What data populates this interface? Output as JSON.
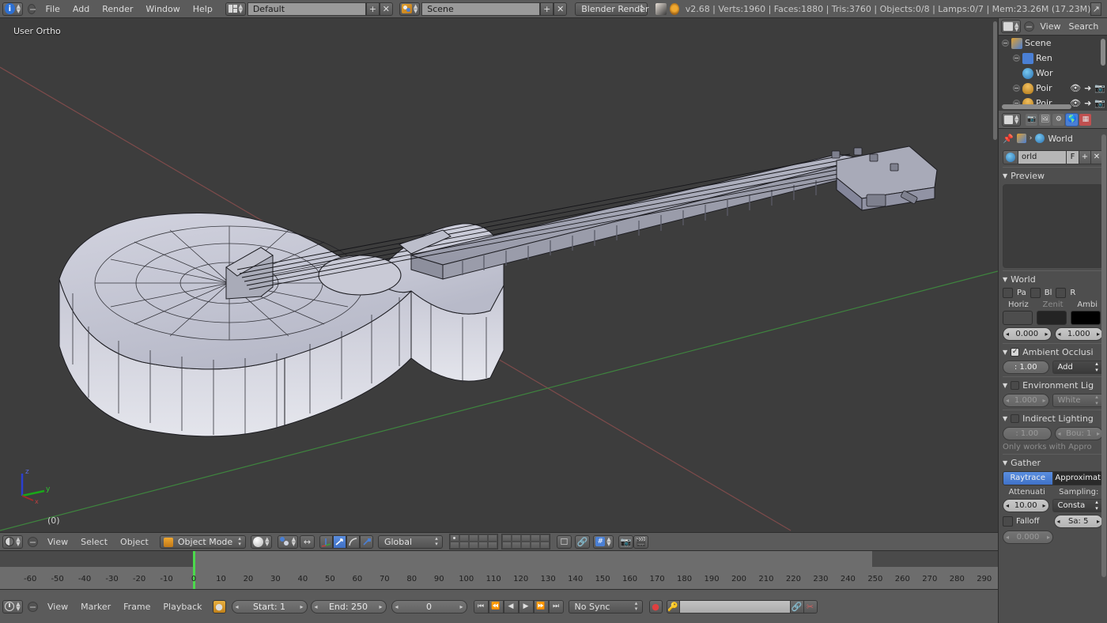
{
  "topbar": {
    "editor_icon": "info-editor-icon",
    "menus": [
      "File",
      "Add",
      "Render",
      "Window",
      "Help"
    ],
    "screen_layout": {
      "icon": "screen-layout-icon",
      "value": "Default",
      "add_label": "+",
      "remove_label": "✕"
    },
    "scene": {
      "icon": "scene-icon",
      "value": "Scene",
      "add_label": "+",
      "remove_label": "✕"
    },
    "render_engine": "Blender Render",
    "status": "v2.68 | Verts:1960 | Faces:1880 | Tris:3760 | Objects:0/8 | Lamps:0/7 | Mem:23.26M (17.23M)",
    "maximize_icon": "maximize-icon"
  },
  "viewport": {
    "view_label": "User Ortho",
    "frame_indicator": "(0)",
    "axis_labels": {
      "x": "x",
      "y": "y",
      "z": "z"
    },
    "colors": {
      "background": "#3d3d3d",
      "x_axis": "#8c4a4a",
      "y_axis": "#3f8c3f",
      "mesh_light": "#c7c8d4",
      "mesh_dark": "#8e909e"
    }
  },
  "viewport_header": {
    "editor_icon": "3d-view-editor-icon",
    "menus": [
      "View",
      "Select",
      "Object"
    ],
    "mode": {
      "icon": "object-mode-icon",
      "value": "Object Mode"
    },
    "shading": {
      "icon": "solid-shading-icon"
    },
    "pivot": {
      "icon": "pivot-median-icon"
    },
    "snap_onion": {
      "icon": "snap-onion-icon"
    },
    "manipulators": [
      {
        "name": "translate-manipulator-icon",
        "active": false
      },
      {
        "name": "rotate-manipulator-icon",
        "active": true
      },
      {
        "name": "arc-manipulator-icon",
        "active": false
      },
      {
        "name": "scale-manipulator-icon",
        "active": false
      }
    ],
    "transform_orientation": "Global",
    "layers": {
      "group_one": [
        true,
        false,
        false,
        false,
        false,
        false,
        false,
        false,
        false,
        false
      ],
      "group_two": [
        false,
        false,
        false,
        false,
        false,
        false,
        false,
        false,
        false,
        false
      ]
    },
    "extra_icons": [
      "render-border-icon",
      "magnet-snap-icon",
      "snap-element-icon",
      "render-preview-icon",
      "render-animation-icon"
    ]
  },
  "timeline": {
    "ruler_ticks": [
      -60,
      -50,
      -40,
      -30,
      -20,
      -10,
      0,
      10,
      20,
      30,
      40,
      50,
      60,
      70,
      80,
      90,
      100,
      110,
      120,
      130,
      140,
      150,
      160,
      170,
      180,
      190,
      200,
      210,
      220,
      230,
      240,
      250,
      260,
      270,
      280,
      290
    ],
    "playhead_frame": 0,
    "editor_icon": "timeline-editor-icon",
    "menus": [
      "View",
      "Marker",
      "Frame",
      "Playback"
    ],
    "record_icon": "auto-key-icon",
    "start": "Start: 1",
    "end": "End: 250",
    "current_frame": "0",
    "playback_buttons": [
      "jump-start-icon",
      "prev-keyframe-icon",
      "play-reverse-icon",
      "play-icon",
      "next-keyframe-icon",
      "jump-end-icon"
    ],
    "sync_mode": "No Sync",
    "rec_icon": "record-icon",
    "key_icon": "keying-set-icon",
    "keying_value": "",
    "link_icon": "link-icon",
    "scissors_icon": "scissors-icon"
  },
  "outliner": {
    "editor_icon": "outliner-editor-icon",
    "menus": [
      "View",
      "Search"
    ],
    "rows": [
      {
        "indent": 0,
        "label": "Scene",
        "icon": "scene-icon",
        "expander": "collapse",
        "toggles": []
      },
      {
        "indent": 1,
        "label": "Ren",
        "icon": "renderlayers-icon",
        "expander": "expand",
        "toggles": []
      },
      {
        "indent": 1,
        "label": "Wor",
        "icon": "world-icon",
        "expander": "none",
        "toggles": []
      },
      {
        "indent": 1,
        "label": "Poir",
        "icon": "lamp-icon",
        "expander": "expand",
        "toggles": [
          "eye-icon",
          "cursor-icon",
          "camera-icon"
        ]
      },
      {
        "indent": 1,
        "label": "Poir",
        "icon": "lamp-icon",
        "expander": "expand",
        "toggles": [
          "eye-icon",
          "cursor-icon",
          "camera-icon"
        ]
      }
    ]
  },
  "properties": {
    "tabs": [
      {
        "name": "render-tab",
        "icon": "camera-back-icon",
        "active": false
      },
      {
        "name": "render-layers-tab",
        "icon": "images-icon",
        "active": false
      },
      {
        "name": "scene-tab",
        "icon": "scene-data-icon",
        "active": false
      },
      {
        "name": "world-tab",
        "icon": "world-icon",
        "active": true
      },
      {
        "name": "texture-tab",
        "icon": "checker-icon",
        "active": false
      }
    ],
    "breadcrumb": {
      "pin_icon": "pin-icon",
      "scene_icon": "scene-icon",
      "sep": "›",
      "world_icon": "world-icon",
      "label": "World"
    },
    "datablock": {
      "icon": "world-icon",
      "name": "orld",
      "fake_user": "F",
      "add": "+",
      "remove": "✕"
    },
    "panels": {
      "preview": {
        "title": "Preview"
      },
      "world": {
        "title": "World",
        "toggles": [
          {
            "label": "Pa",
            "checked": false
          },
          {
            "label": "Bl",
            "checked": false
          },
          {
            "label": "R",
            "checked": false
          }
        ],
        "color_labels": [
          "Horiz",
          "Zenit",
          "Ambi"
        ],
        "colors": [
          "#4d4d4d",
          "#242424",
          "#000000"
        ],
        "zenit_dim": true,
        "values": [
          "0.000",
          "1.000"
        ]
      },
      "ambient_occlusion": {
        "title": "Ambient Occlusi",
        "checked": true,
        "factor": ": 1.00",
        "blend_mode": "Add"
      },
      "environment_lighting": {
        "title": "Environment Lig",
        "checked": false,
        "energy": "1.000",
        "source": "White"
      },
      "indirect_lighting": {
        "title": "Indirect Lighting",
        "checked": false,
        "factor": ": 1.00",
        "bounces": "Bou: 1",
        "note": "Only works with Appro"
      },
      "gather": {
        "title": "Gather",
        "methods": [
          {
            "label": "Raytrace",
            "active": true
          },
          {
            "label": "Approximat",
            "active": false
          }
        ],
        "attenuation_label": "Attenuati",
        "sampling_label": "Sampling:",
        "distance": "10.00",
        "sampling_mode": "Consta",
        "falloff_label": "Falloff",
        "falloff_checked": false,
        "samples": "Sa: 5",
        "strength": "0.000"
      }
    }
  }
}
